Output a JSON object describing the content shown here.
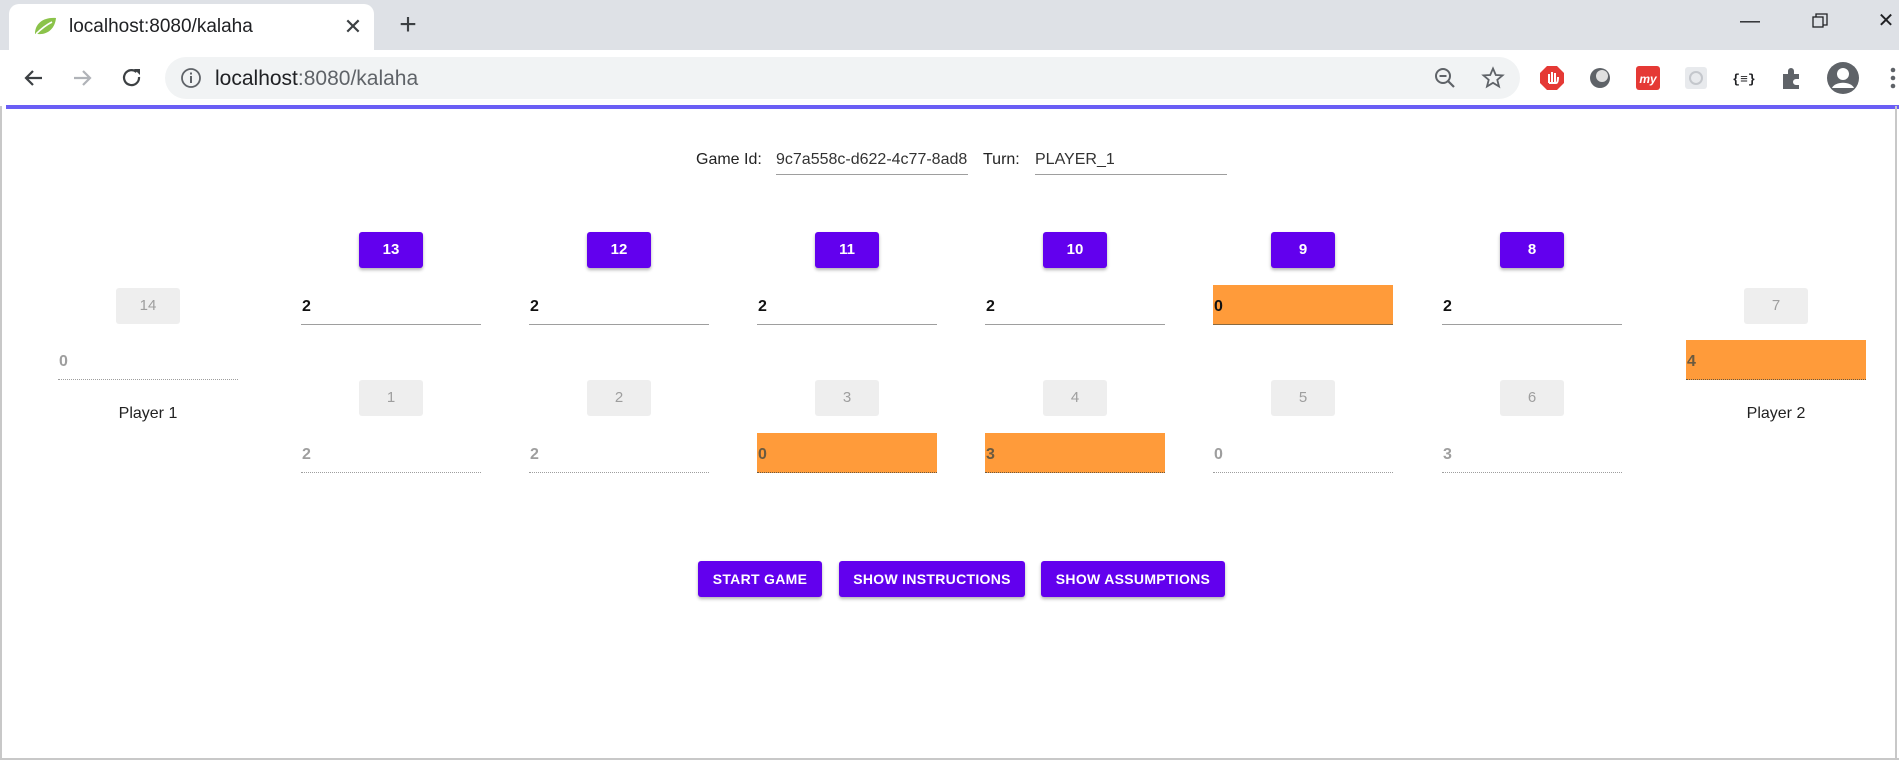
{
  "browser": {
    "tab_title": "localhost:8080/kalaha",
    "url_host": "localhost",
    "url_path": ":8080/kalaha",
    "accent": "#6a5ef5"
  },
  "game": {
    "game_id_label": "Game Id:",
    "game_id_value": "9c7a558c-d622-4c77-8ad8-",
    "turn_label": "Turn:",
    "turn_value": "PLAYER_1"
  },
  "board": {
    "top_pits": [
      {
        "label": "13",
        "stones": "2",
        "highlight": false
      },
      {
        "label": "12",
        "stones": "2",
        "highlight": false
      },
      {
        "label": "11",
        "stones": "2",
        "highlight": false
      },
      {
        "label": "10",
        "stones": "2",
        "highlight": false
      },
      {
        "label": "9",
        "stones": "0",
        "highlight": true
      },
      {
        "label": "8",
        "stones": "2",
        "highlight": false
      }
    ],
    "bottom_pits": [
      {
        "label": "1",
        "stones": "2",
        "highlight": false
      },
      {
        "label": "2",
        "stones": "2",
        "highlight": false
      },
      {
        "label": "3",
        "stones": "0",
        "highlight": true
      },
      {
        "label": "4",
        "stones": "3",
        "highlight": true
      },
      {
        "label": "5",
        "stones": "0",
        "highlight": false
      },
      {
        "label": "6",
        "stones": "3",
        "highlight": false
      }
    ],
    "left_store": {
      "label": "14",
      "stones": "0",
      "player": "Player 1"
    },
    "right_store": {
      "label": "7",
      "stones": "4",
      "player": "Player 2"
    },
    "pit_button_color": "#6200ee",
    "highlight_color": "#ff9b3a"
  },
  "actions": {
    "start": "START GAME",
    "instructions": "SHOW INSTRUCTIONS",
    "assumptions": "SHOW ASSUMPTIONS"
  }
}
